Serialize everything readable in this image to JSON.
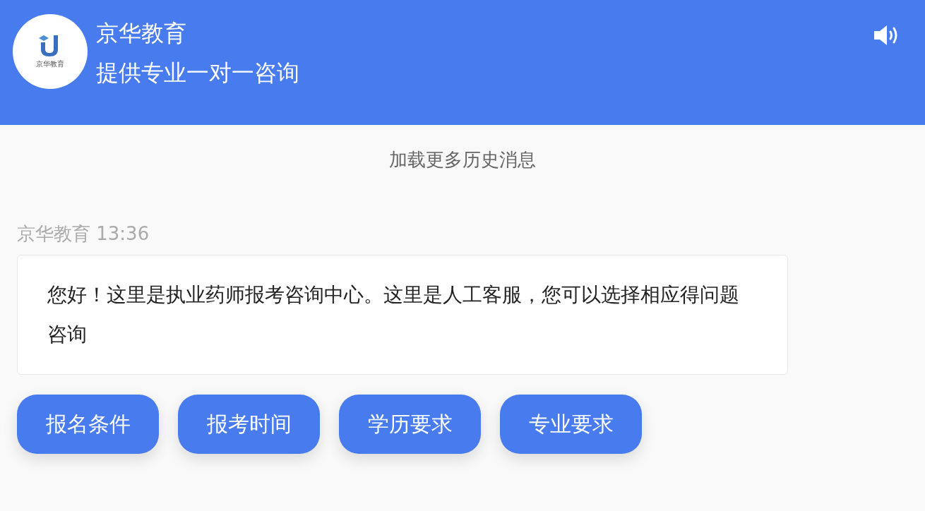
{
  "header": {
    "logo_text": "京华教育",
    "title": "京华教育",
    "subtitle": "提供专业一对一咨询"
  },
  "load_more": "加载更多历史消息",
  "messages": [
    {
      "sender": "京华教育",
      "time": "13:36",
      "text": "您好！这里是执业药师报考咨询中心。这里是人工客服，您可以选择相应得问题咨询"
    }
  ],
  "quick_replies": [
    "报名条件",
    "报考时间",
    "学历要求",
    "专业要求"
  ]
}
